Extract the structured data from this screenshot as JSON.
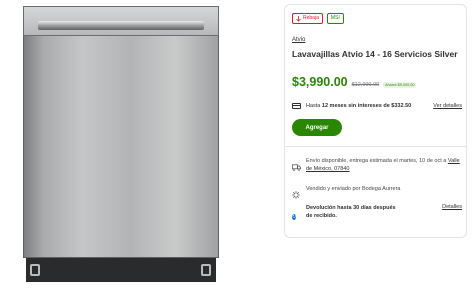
{
  "badges": {
    "rebaja": "Rebaja",
    "msi": "MSI"
  },
  "product": {
    "brand": "Atvio",
    "title": "Lavavajillas Atvio 14 - 16 Servicios Silver",
    "price": "$3,990.00",
    "was_price": "$12,990.00",
    "savings": "Ahorra $9,000.00"
  },
  "installments": {
    "prefix": "Hasta ",
    "strong": "12 meses sin intereses de $332.50",
    "details_link": "Ver detalles"
  },
  "add_button": "Agregar",
  "delivery": {
    "text": "Envío disponible, entrega estimada el martes, 10 de oct a ",
    "location_link": "Valle de México, 07840"
  },
  "seller": {
    "text": "Vendido y enviado por Bodega Aurrera"
  },
  "returns": {
    "text": "Devolución hasta 30 días después de recibido.",
    "details_link": "Detalles"
  },
  "colors": {
    "accent_green": "#2a8703",
    "sale_red": "#de1c24",
    "info_blue": "#0071dc"
  },
  "icons": {
    "rebaja": "down-arrow-icon",
    "card": "credit-card-icon",
    "truck": "truck-icon",
    "spark": "spark-icon",
    "return": "return-icon"
  }
}
